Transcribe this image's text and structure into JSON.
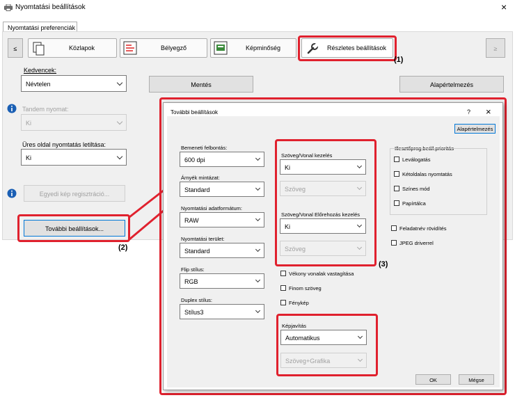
{
  "window": {
    "title": "Nyomtatási beállítások",
    "close": "×"
  },
  "tab": {
    "label": "Nyomtatási preferenciák"
  },
  "categories": {
    "prev": "≤",
    "next": "≥",
    "items": [
      {
        "label": "Közlapok"
      },
      {
        "label": "Bélyegző"
      },
      {
        "label": "Képminőség"
      },
      {
        "label": "Részletes beállítások"
      }
    ]
  },
  "favorites": {
    "label": "Kedvencek:",
    "value": "Névtelen",
    "save": "Mentés",
    "default": "Alapértelmezés"
  },
  "tandem": {
    "label": "Tandem nyomat:",
    "value": "Ki"
  },
  "blank": {
    "label": "Üres oldal nyomtatás letiltása:",
    "value": "Ki"
  },
  "custom_image": {
    "button": "Egyedi kép regisztráció..."
  },
  "more": {
    "button": "További beállítások..."
  },
  "callouts": {
    "c1": "(1)",
    "c2": "(2)",
    "c3": "(3)"
  },
  "dialog": {
    "title": "További beállítások",
    "help": "?",
    "close": "×",
    "default": "Alapértelmezés",
    "ok": "OK",
    "cancel": "Mégse",
    "input_res": {
      "label": "Bemeneti felbontás:",
      "value": "600 dpi"
    },
    "shadow": {
      "label": "Árnyék mintázat:",
      "value": "Standard"
    },
    "data_format": {
      "label": "Nyomtatási adatformátum:",
      "value": "RAW"
    },
    "print_area": {
      "label": "Nyomtatási terület:",
      "value": "Standard"
    },
    "flip": {
      "label": "Flip stílus:",
      "value": "RGB"
    },
    "duplex": {
      "label": "Duplex stílus:",
      "value": "Stílus3"
    },
    "text_line": {
      "label": "Szöveg/Vonal kezelés",
      "value": "Ki",
      "sub": "Szöveg"
    },
    "text_line_pre": {
      "label": "Szöveg/Vonal Előrehozás kezelés",
      "value": "Ki",
      "sub": "Szöveg"
    },
    "thin_lines": "Vékony vonalak vastagítása",
    "fine_text": "Finom szöveg",
    "photo": "Fénykép",
    "image_fix": {
      "label": "Képjavítás",
      "value": "Automatikus",
      "sub": "Szöveg+Grafika"
    },
    "driver_priority": {
      "label": "Illesztőprog.beáll.prioritás",
      "items": [
        "Leválogatás",
        "Kétoldalas nyomtatás",
        "Színes mód",
        "Papírtálca"
      ]
    },
    "job_short": "Feladatnév rövidítés",
    "jpeg": "JPEG driverrel"
  }
}
